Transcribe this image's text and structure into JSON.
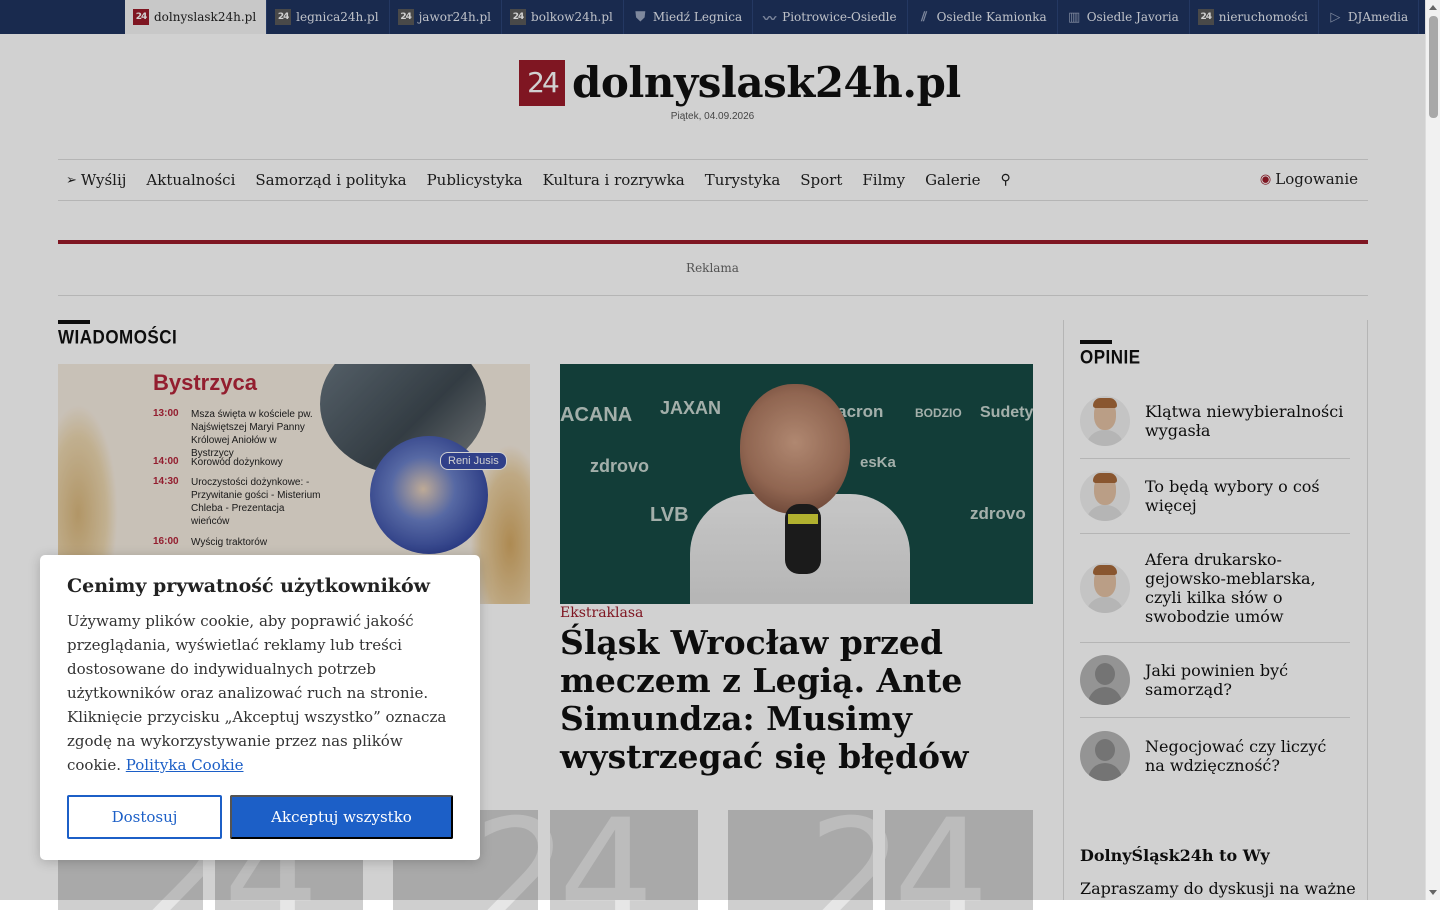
{
  "network": [
    {
      "label": "dolnyslask24h.pl",
      "icon": "24-badge-icon",
      "active": true
    },
    {
      "label": "legnica24h.pl",
      "icon": "24-badge-icon"
    },
    {
      "label": "jawor24h.pl",
      "icon": "24-badge-icon"
    },
    {
      "label": "bolkow24h.pl",
      "icon": "24-badge-icon"
    },
    {
      "label": "Miedź Legnica",
      "icon": "shield-icon"
    },
    {
      "label": "Piotrowice-Osiedle",
      "icon": "wave-icon"
    },
    {
      "label": "Osiedle Kamionka",
      "icon": "slash-icon"
    },
    {
      "label": "Osiedle Javoria",
      "icon": "building-icon"
    },
    {
      "label": "nieruchomości",
      "icon": "24-badge-icon"
    },
    {
      "label": "DJAmedia",
      "icon": "play-icon"
    }
  ],
  "header": {
    "logo_badge": "24",
    "site_name": "dolnyslask24h.pl",
    "date": "Piątek, 04.09.2026"
  },
  "nav": {
    "items": [
      "Wyślij",
      "Aktualności",
      "Samorząd i polityka",
      "Publicystyka",
      "Kultura i rozrywka",
      "Turystyka",
      "Sport",
      "Filmy",
      "Galerie"
    ],
    "login": "Logowanie"
  },
  "ad_label": "Reklama",
  "news": {
    "section_title": "WIADOMOŚCI",
    "poster": {
      "title": "Bystrzyca",
      "rows": [
        {
          "time": "13:00",
          "desc": "Msza święta w kościele pw. Najświętszej Maryi Panny Królowej Aniołów w Bystrzycy"
        },
        {
          "time": "14:00",
          "desc": "Korowód dożynkowy"
        },
        {
          "time": "14:30",
          "desc": "Uroczystości dożynkowe: - Przywitanie gości - Misterium Chleba - Prezentacja wieńców"
        },
        {
          "time": "16:00",
          "desc": "Wyścig traktorów"
        }
      ],
      "artist": "Reni Jusis"
    },
    "feature": {
      "brands": [
        "JAXAN",
        "macron",
        "BODZIO",
        "Sudety",
        "zdrovo",
        "esKa",
        "LVB",
        "ACANA"
      ],
      "category": "Ekstraklasa",
      "headline": "Śląsk Wrocław przed meczem z Legią. Ante Simundza: Musimy wystrzegać się błędów"
    },
    "placeholder_text": "24"
  },
  "opinions": {
    "section_title": "OPINIE",
    "items": [
      {
        "title": "Klątwa niewybieralności wygasła",
        "avatar": "photo"
      },
      {
        "title": "To będą wybory o coś więcej",
        "avatar": "photo"
      },
      {
        "title": "Afera drukarsko-gejowsko-meblarska, czyli kilka słów o swobodzie umów",
        "avatar": "photo"
      },
      {
        "title": "Jaki powinien być samorząd?",
        "avatar": "anon"
      },
      {
        "title": "Negocjować czy liczyć na wdzięczność?",
        "avatar": "anon"
      }
    ],
    "promo_title": "DolnyŚląsk24h to Wy",
    "promo_text": "Zapraszamy do dyskusji na ważne"
  },
  "cookie": {
    "title": "Cenimy prywatność użytkowników",
    "body": "Używamy plików cookie, aby poprawić jakość przeglądania, wyświetlać reklamy lub treści dostosowane do indywidualnych potrzeb użytkowników oraz analizować ruch na stronie. Kliknięcie przycisku „Akceptuj wszystko” oznacza zgodę na wykorzystywanie przez nas plików cookie.",
    "policy_link": "Polityka Cookie",
    "customize": "Dostosuj",
    "accept": "Akceptuj wszystko"
  },
  "colors": {
    "brand": "#9b1c2a",
    "topbar": "#1f3460",
    "accent": "#1c5fc7"
  }
}
